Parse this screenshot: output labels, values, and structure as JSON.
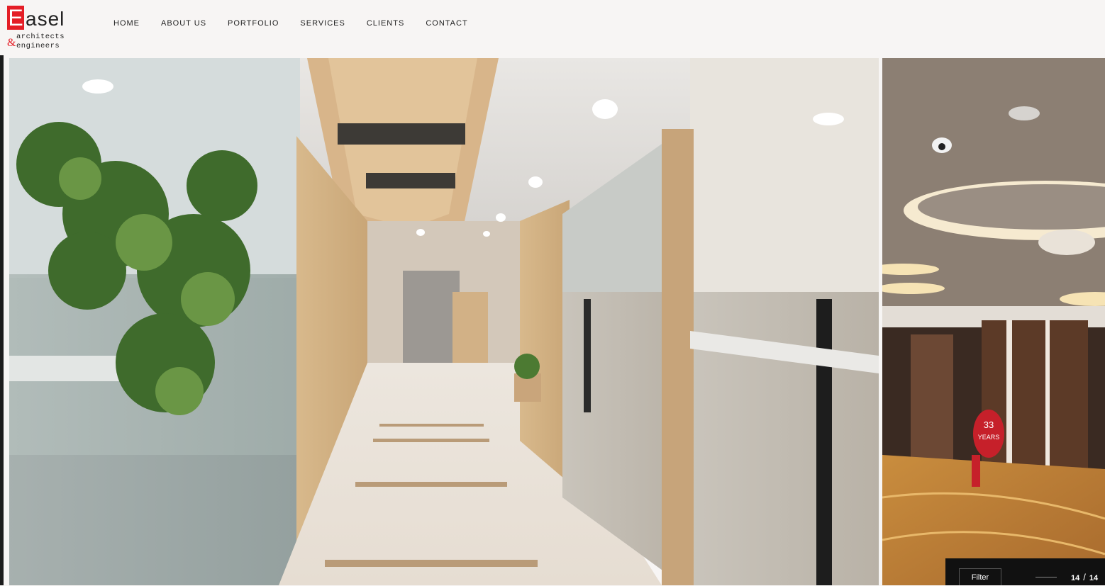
{
  "brand": {
    "initial": "E",
    "name_rest": "asel",
    "ampersand": "&",
    "tagline_1": "architects",
    "tagline_2": "engineers",
    "accent_color": "#e41e26"
  },
  "nav": {
    "items": [
      {
        "label": "HOME"
      },
      {
        "label": "ABOUT US"
      },
      {
        "label": "PORTFOLIO"
      },
      {
        "label": "SERVICES"
      },
      {
        "label": "CLIENTS"
      },
      {
        "label": "CONTACT"
      }
    ]
  },
  "gallery": {
    "main_image": "office-corridor-photo",
    "next_image": "lobby-lounge-photo",
    "filter_label": "Filter",
    "current": "14",
    "separator": "/",
    "total": "14",
    "sign_text_1": "33",
    "sign_text_2": "YEARS"
  }
}
